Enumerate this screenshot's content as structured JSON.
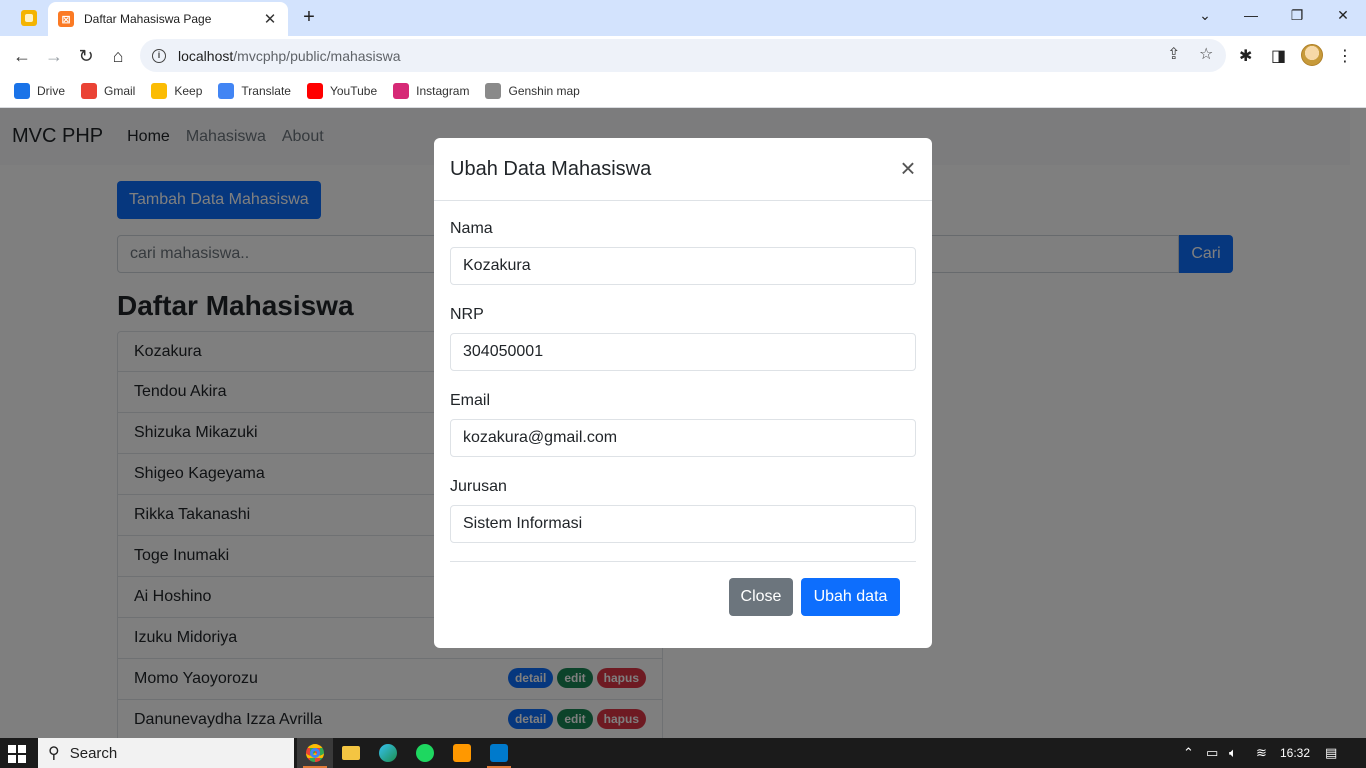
{
  "browser": {
    "tab_title": "Daftar Mahasiswa Page",
    "tab_close": "✕",
    "new_tab": "+",
    "url_host": "localhost",
    "url_path": "/mvcphp/public/mahasiswa",
    "bookmarks": [
      {
        "label": "Drive",
        "icon": "drive-icon",
        "color": "#1a73e8"
      },
      {
        "label": "Gmail",
        "icon": "gmail-icon",
        "color": "#ea4335"
      },
      {
        "label": "Keep",
        "icon": "keep-icon",
        "color": "#fbbc04"
      },
      {
        "label": "Translate",
        "icon": "translate-icon",
        "color": "#4285f4"
      },
      {
        "label": "YouTube",
        "icon": "youtube-icon",
        "color": "#ff0000"
      },
      {
        "label": "Instagram",
        "icon": "instagram-icon",
        "color": "#d62976"
      },
      {
        "label": "Genshin map",
        "icon": "genshin-map-icon",
        "color": "#8a8a8a"
      }
    ]
  },
  "app": {
    "brand": "MVC PHP",
    "nav": [
      "Home",
      "Mahasiswa",
      "About"
    ],
    "add_button": "Tambah Data Mahasiswa",
    "search_placeholder": "cari mahasiswa..",
    "search_button": "Cari",
    "list_title": "Daftar Mahasiswa",
    "students": [
      "Kozakura",
      "Tendou Akira",
      "Shizuka Mikazuki",
      "Shigeo Kageyama",
      "Rikka Takanashi",
      "Toge Inumaki",
      "Ai Hoshino",
      "Izuku Midoriya",
      "Momo Yaoyorozu",
      "Danunevaydha Izza Avrilla"
    ],
    "badges": {
      "detail": "detail",
      "edit": "edit",
      "hapus": "hapus"
    }
  },
  "modal": {
    "title": "Ubah Data Mahasiswa",
    "close_icon": "×",
    "fields": [
      {
        "label": "Nama",
        "value": "Kozakura"
      },
      {
        "label": "NRP",
        "value": "304050001"
      },
      {
        "label": "Email",
        "value": "kozakura@gmail.com"
      },
      {
        "label": "Jurusan",
        "value": "Sistem Informasi"
      }
    ],
    "close_button": "Close",
    "save_button": "Ubah data"
  },
  "taskbar": {
    "search_label": "Search",
    "time": "16:32"
  },
  "colors": {
    "primary": "#0d6efd",
    "secondary": "#6c757d",
    "success": "#198754",
    "danger": "#dc3545",
    "chrome_tab_bg": "#d3e3fd"
  }
}
